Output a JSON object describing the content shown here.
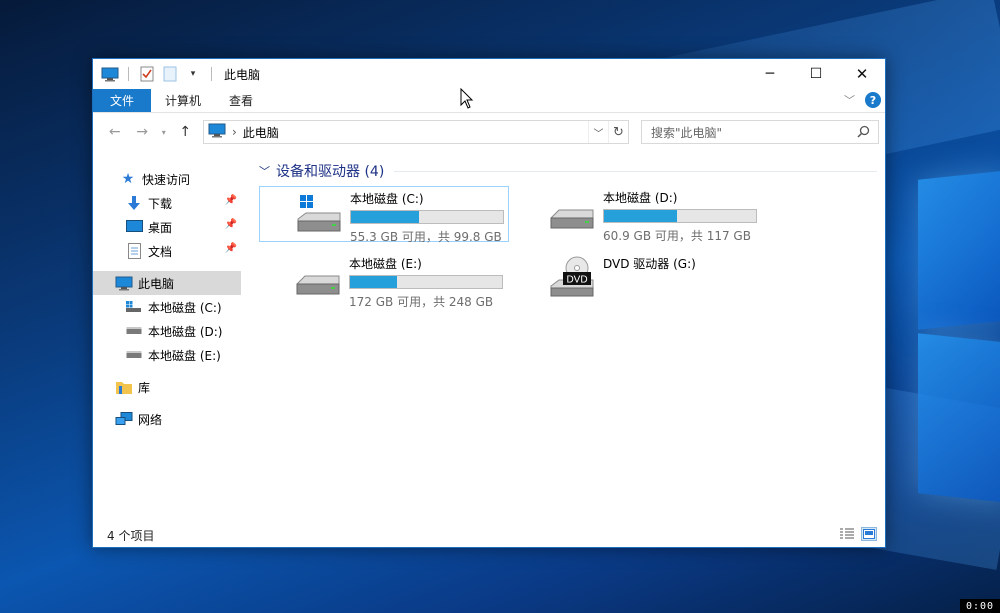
{
  "window": {
    "title": "此电脑",
    "minimize_label": "─",
    "maximize_label": "☐",
    "close_label": "✕"
  },
  "ribbon": {
    "tabs": [
      {
        "label": "文件"
      },
      {
        "label": "计算机"
      },
      {
        "label": "查看"
      }
    ],
    "help_label": "?"
  },
  "address": {
    "crumb": "此电脑"
  },
  "search": {
    "placeholder": "搜索\"此电脑\""
  },
  "sidebar": {
    "quick_access": "快速访问",
    "pinned": [
      {
        "label": "下载"
      },
      {
        "label": "桌面"
      },
      {
        "label": "文档"
      }
    ],
    "this_pc": "此电脑",
    "drives": [
      {
        "label": "本地磁盘 (C:)"
      },
      {
        "label": "本地磁盘 (D:)"
      },
      {
        "label": "本地磁盘 (E:)"
      }
    ],
    "library": "库",
    "network": "网络"
  },
  "content": {
    "group_header": "设备和驱动器 (4)",
    "drives": [
      {
        "name": "本地磁盘 (C:)",
        "free_text": "55.3 GB 可用，共 99.8 GB",
        "used_fraction": 0.446,
        "icon": "windows-drive-icon"
      },
      {
        "name": "本地磁盘 (D:)",
        "free_text": "60.9 GB 可用，共 117 GB",
        "used_fraction": 0.479,
        "icon": "hard-drive-icon"
      },
      {
        "name": "本地磁盘 (E:)",
        "free_text": "172 GB 可用，共 248 GB",
        "used_fraction": 0.306,
        "icon": "hard-drive-icon"
      },
      {
        "name": "DVD 驱动器 (G:)",
        "icon": "dvd-drive-icon",
        "badge": "DVD"
      }
    ]
  },
  "status": {
    "items_count": "4 个项目"
  },
  "clock": "0:00",
  "colors": {
    "accent": "#1979ca",
    "bar_fill": "#26a0da",
    "group_header": "#1e3287"
  }
}
